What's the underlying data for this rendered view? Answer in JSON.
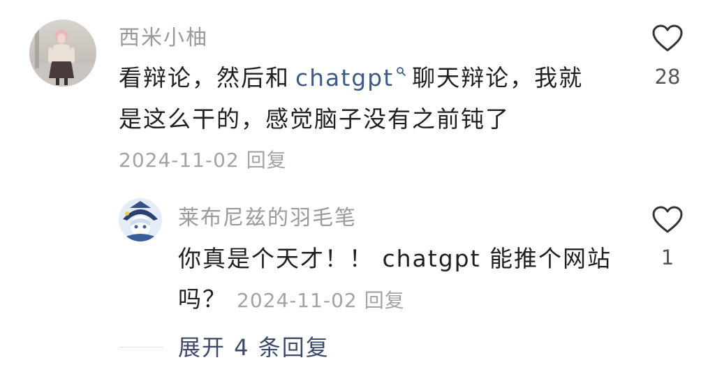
{
  "comment": {
    "username": "西米小柚",
    "line1_before": "看辩论，然后和",
    "link_text": "chatgpt",
    "link_icon": "search-icon",
    "line1_after": "聊天辩论，我就",
    "line2": "是这么干的，感觉脑子没有之前钝了",
    "date": "2024-11-02",
    "reply_label": "回复",
    "like_icon": "heart-outline-icon",
    "like_count": "28"
  },
  "reply": {
    "username": "莱布尼兹的羽毛笔",
    "line1": "你真是个天才！！ chatgpt 能推个网站",
    "line2": "吗？",
    "date": "2024-11-02",
    "reply_label": "回复",
    "like_icon": "heart-outline-icon",
    "like_count": "1"
  },
  "expand": {
    "label": "展开 4 条回复"
  },
  "colors": {
    "text": "#1f1f1f",
    "muted": "#9a9a9a",
    "link": "#3d5a86",
    "expand": "#3c4967"
  }
}
